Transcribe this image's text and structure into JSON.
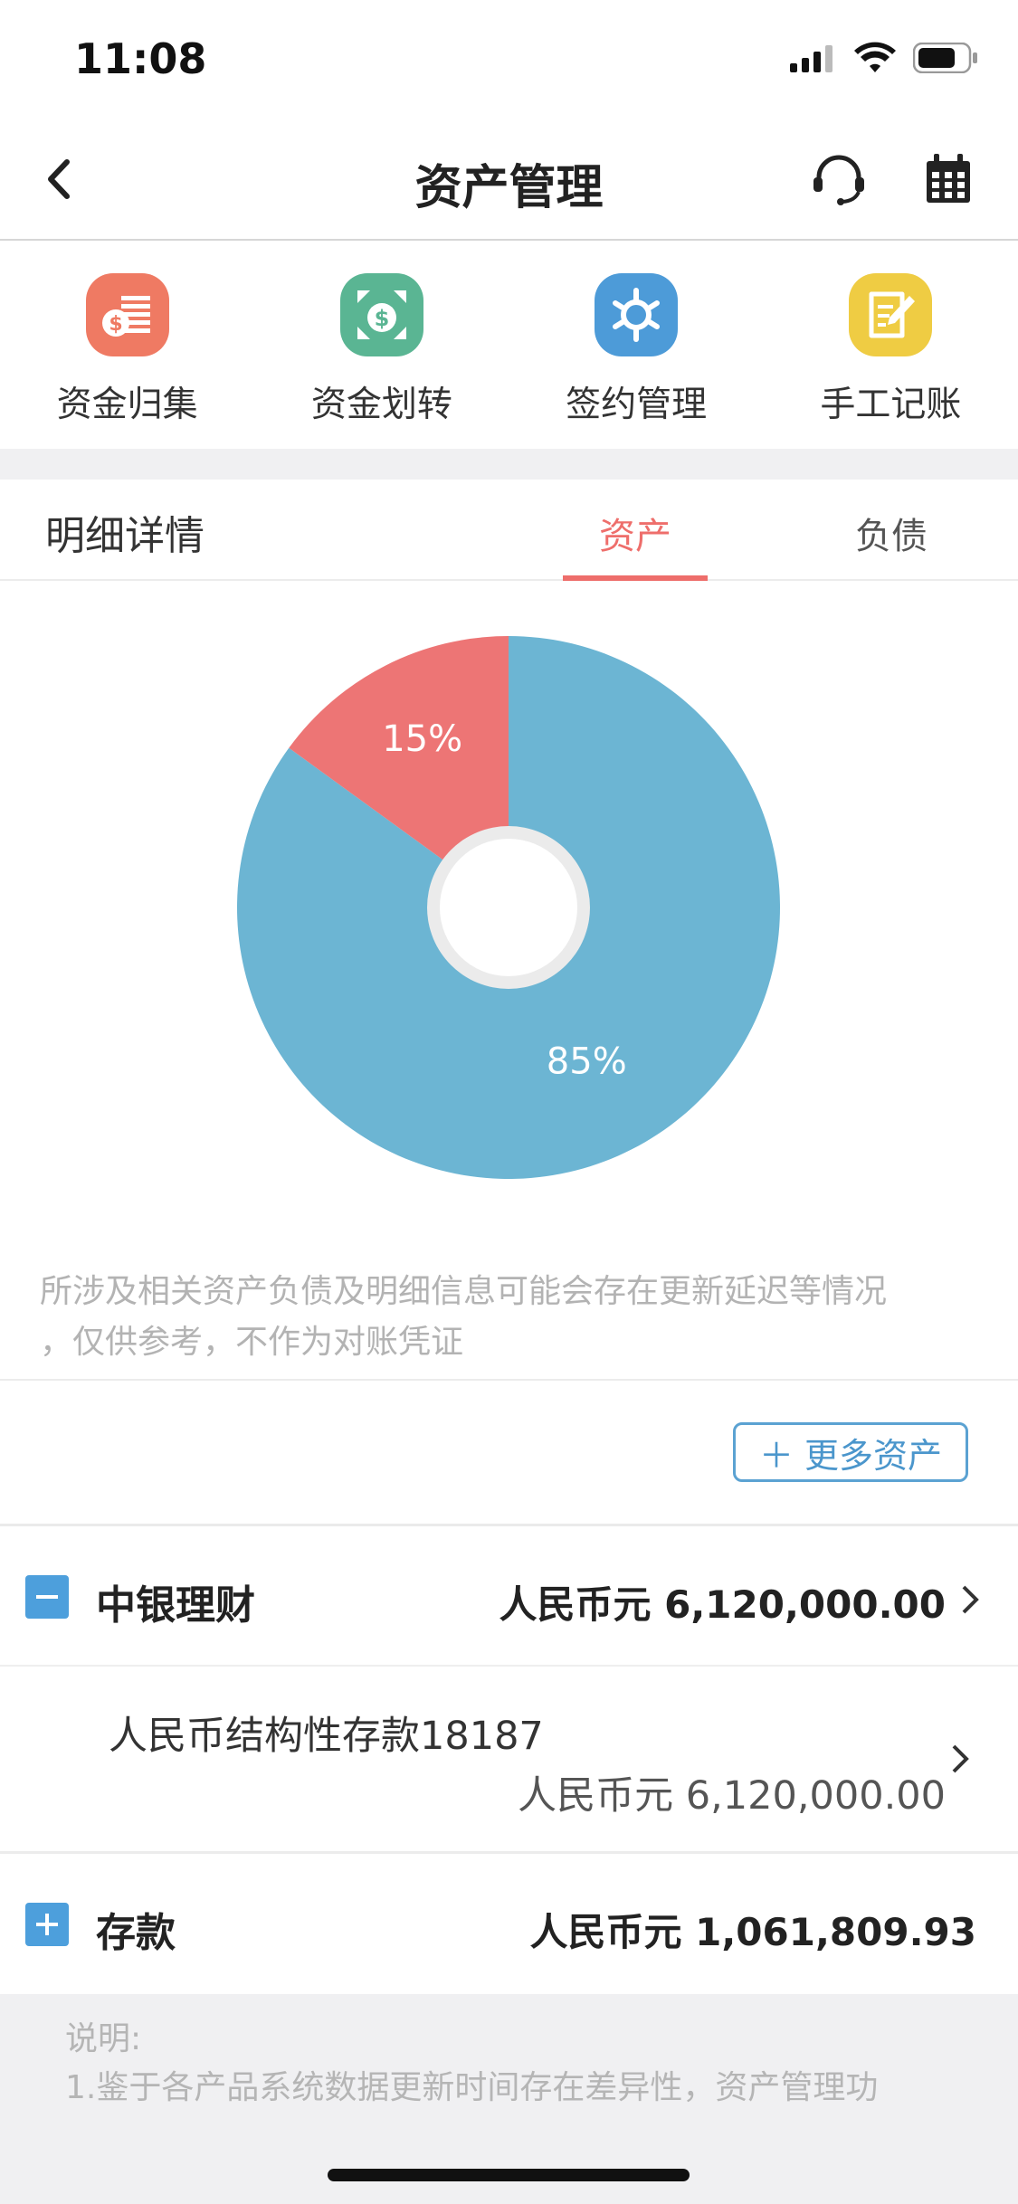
{
  "status": {
    "time": "11:08"
  },
  "nav": {
    "title": "资产管理"
  },
  "actions": [
    {
      "label": "资金归集",
      "icon": "money-collection-icon",
      "color": "#ef7a63"
    },
    {
      "label": "资金划转",
      "icon": "money-transfer-icon",
      "color": "#5ab593"
    },
    {
      "label": "签约管理",
      "icon": "signing-manage-icon",
      "color": "#4d9bd8"
    },
    {
      "label": "手工记账",
      "icon": "manual-bookkeeping-icon",
      "color": "#efcc43"
    }
  ],
  "detail": {
    "title": "明细详情",
    "tab_assets": "资产",
    "tab_liabilities": "负债"
  },
  "chart_data": {
    "type": "pie",
    "categories": [
      "",
      ""
    ],
    "values": [
      85,
      15
    ],
    "labels": [
      "85%",
      "15%"
    ],
    "colors": [
      "#6cb5d3",
      "#ed7575"
    ]
  },
  "note": {
    "line1": "所涉及相关资产负债及明细信息可能会存在更新延迟等情况",
    "line2": "，仅供参考，不作为对账凭证"
  },
  "more_button": "＋ 更多资产",
  "groups": [
    {
      "name": "中银理财",
      "amount": "人民币元 6,120,000.00",
      "toggle": "−"
    },
    {
      "name": "存款",
      "amount": "人民币元 1,061,809.93",
      "toggle": "+"
    }
  ],
  "items": [
    {
      "name": "人民币结构性存款18187",
      "amount": "人民币元 6,120,000.00"
    }
  ],
  "footer": {
    "title": "说明:",
    "text": "1.鉴于各产品系统数据更新时间存在差异性，资产管理功"
  }
}
